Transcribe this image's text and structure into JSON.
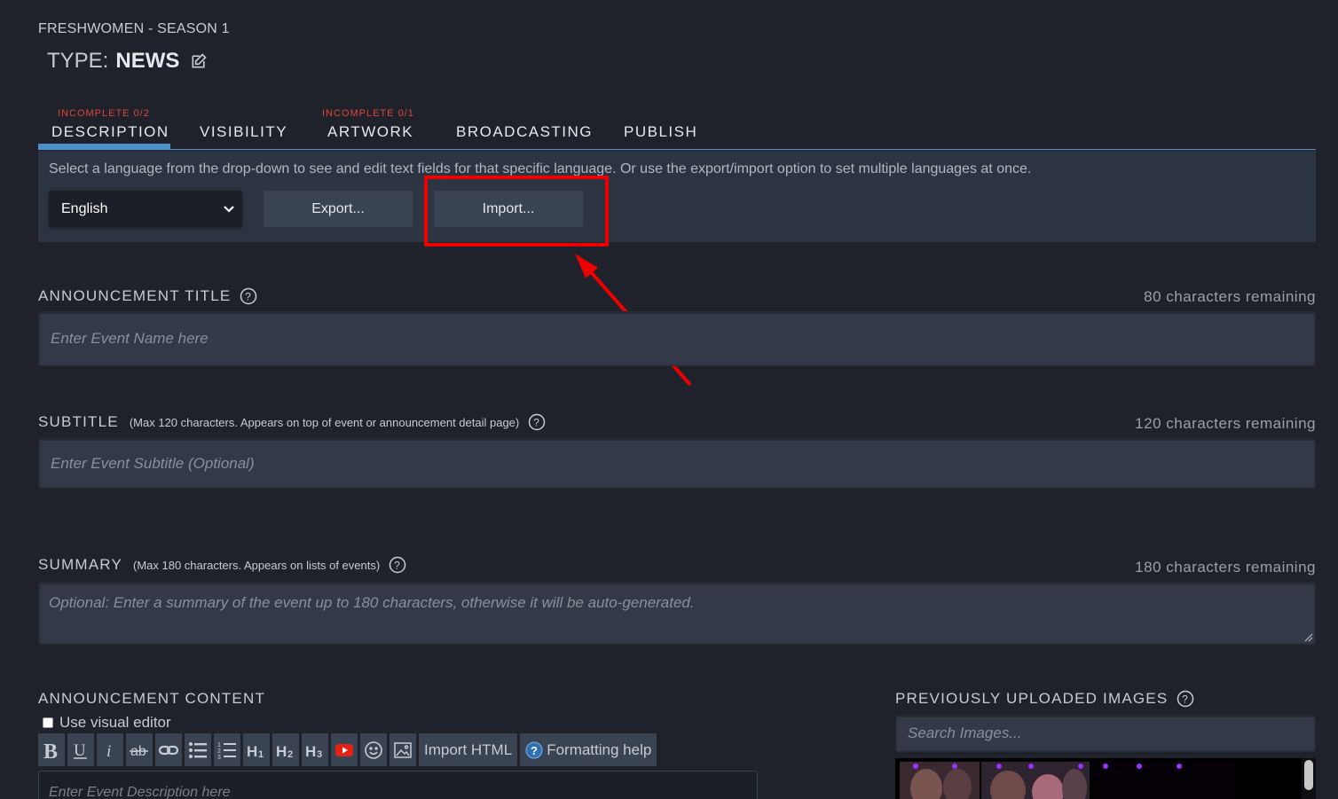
{
  "header": {
    "breadcrumb": "FRESHWOMEN - SEASON 1",
    "type_label": "TYPE:",
    "type_value": "NEWS"
  },
  "tabs": [
    {
      "label": "DESCRIPTION",
      "warning": "INCOMPLETE 0/2",
      "active": true
    },
    {
      "label": "VISIBILITY",
      "warning": ""
    },
    {
      "label": "ARTWORK",
      "warning": "INCOMPLETE 0/1"
    },
    {
      "label": "BROADCASTING",
      "warning": ""
    },
    {
      "label": "PUBLISH",
      "warning": ""
    }
  ],
  "language_panel": {
    "info": "Select a language from the drop-down to see and edit text fields for that specific language. Or use the export/import option to set multiple languages at once.",
    "selected_language": "English",
    "export_label": "Export...",
    "import_label": "Import..."
  },
  "announcement_title": {
    "label": "ANNOUNCEMENT TITLE",
    "remaining": "80 characters remaining",
    "placeholder": "Enter Event Name here"
  },
  "subtitle": {
    "label": "SUBTITLE",
    "hint": "(Max 120 characters. Appears on top of event or announcement detail page)",
    "remaining": "120 characters remaining",
    "placeholder": "Enter Event Subtitle (Optional)"
  },
  "summary": {
    "label": "SUMMARY",
    "hint": "(Max 180 characters. Appears on lists of events)",
    "remaining": "180 characters remaining",
    "placeholder": "Optional: Enter a summary of the event up to 180 characters, otherwise it will be auto-generated."
  },
  "content": {
    "label": "ANNOUNCEMENT CONTENT",
    "visual_editor_label": "Use visual editor",
    "import_html_label": "Import HTML",
    "formatting_help_label": "Formatting help",
    "placeholder": "Enter Event Description here"
  },
  "images": {
    "label": "PREVIOUSLY UPLOADED IMAGES",
    "search_placeholder": "Search Images..."
  },
  "colors": {
    "background": "#1f222a",
    "accent_blue": "#4b90c8",
    "warning_red": "#e0443b",
    "annotation_red": "#ee0000"
  }
}
